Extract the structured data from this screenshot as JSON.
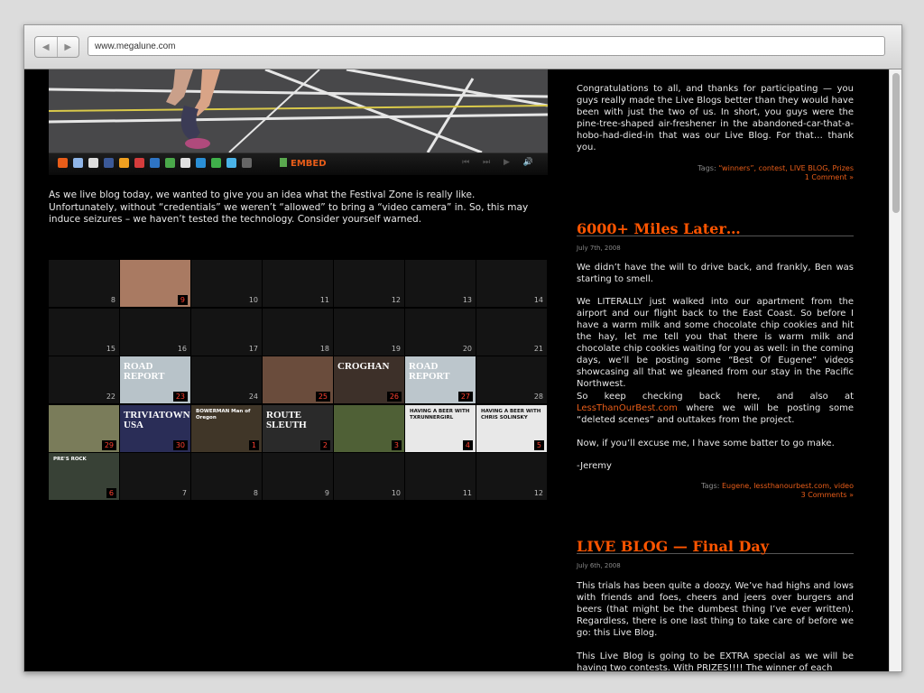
{
  "browser": {
    "url": "www.megalune.com",
    "back_glyph": "◀",
    "forward_glyph": "▶"
  },
  "left": {
    "toolbar": {
      "embed_label": "EMBED",
      "player_glyphs": "⏮ ⏭ ▶ 🔊"
    },
    "intro": "As we live blog today, we wanted to give you an idea what the Festival Zone is really like.  Unfortunately, without “credentials” we weren’t “allowed” to bring a “video camera” in.  So, this may induce seizures – we haven’t tested the technology.  Consider yourself warned.",
    "grid": [
      {
        "n": "8"
      },
      {
        "n": "9",
        "thumb": "#a97a62"
      },
      {
        "n": "10"
      },
      {
        "n": "11"
      },
      {
        "n": "12"
      },
      {
        "n": "13"
      },
      {
        "n": "14"
      },
      {
        "n": "15"
      },
      {
        "n": "16"
      },
      {
        "n": "17"
      },
      {
        "n": "18"
      },
      {
        "n": "19"
      },
      {
        "n": "20"
      },
      {
        "n": "21"
      },
      {
        "n": "22"
      },
      {
        "n": "23",
        "thumb": "#b8c3c9",
        "title": "ROAD REPORT"
      },
      {
        "n": "24"
      },
      {
        "n": "25",
        "thumb": "#6a4c3c"
      },
      {
        "n": "26",
        "thumb": "#3d3029",
        "title": "CROGHAN"
      },
      {
        "n": "27",
        "thumb": "#bcc6cc",
        "title": "ROAD REPORT"
      },
      {
        "n": "28"
      },
      {
        "n": "29",
        "thumb": "#7a7c5a"
      },
      {
        "n": "30",
        "thumb": "#2a2d57",
        "title": "TRIVIATOWN USA"
      },
      {
        "n": "1",
        "thumb": "#403628",
        "sub": "BOWERMAN Man of Oregon"
      },
      {
        "n": "2",
        "thumb": "#2a2a2a",
        "title": "ROUTE SLEUTH"
      },
      {
        "n": "3",
        "thumb": "#4f6036"
      },
      {
        "n": "4",
        "thumb": "#e8e8e8",
        "sub": "HAVING A BEER WITH TXRUNNERGIRL"
      },
      {
        "n": "5",
        "thumb": "#e8e8e8",
        "sub": "HAVING A BEER WITH CHRIS SOLINSKY"
      },
      {
        "n": "6",
        "thumb": "#384136",
        "sub": "PRE'S ROCK"
      },
      {
        "n": "7"
      },
      {
        "n": "8"
      },
      {
        "n": "9"
      },
      {
        "n": "10"
      },
      {
        "n": "11"
      },
      {
        "n": "12"
      }
    ]
  },
  "sidebar": {
    "p1": "Congratulations to all, and thanks for participating — you guys really made the Live Blogs better than they would have been with just the two of us.  In short, you guys were the pine-tree-shaped air-freshener in the abandoned-car-that-a-hobo-had-died-in that was our Live Blog.  For that… thank you.",
    "tags1_prefix": "Tags:",
    "tags1": "“winners”, contest, LIVE BLOG, Prizes",
    "comments1": "1 Comment »",
    "post2_title": "6000+ Miles Later…",
    "post2_date": "July 7th, 2008",
    "p2a": "We didn’t have the will to drive back, and frankly, Ben was starting to smell.",
    "p2b": "We LITERALLY just walked into our apartment from the airport and our flight back to the East Coast.  So before I have a warm milk and some chocolate chip cookies and hit the hay, let me tell you that there is warm milk and chocolate chip cookies waiting for you as well: in the coming days, we’ll be posting some “Best Of Eugene” videos showcasing all that we gleaned from our stay in the Pacific Northwest.",
    "p2c_1": "So keep checking back here, and also at ",
    "p2c_link": "LessThanOurBest.com",
    "p2c_2": " where we will be posting some “deleted scenes” and outtakes from the project.",
    "p2d": "Now, if you’ll excuse me, I have some batter to go make.",
    "p2e": "-Jeremy",
    "tags2_prefix": "Tags:",
    "tags2": "Eugene, lessthanourbest.com, video",
    "comments2": "3 Comments »",
    "post3_title": "LIVE BLOG — Final Day",
    "post3_date": "July 6th, 2008",
    "p3a": "This trials has been quite a doozy.  We’ve had highs and lows with friends and foes, cheers and jeers over burgers and beers (that might be the dumbest thing I’ve ever written). Regardless, there is one last thing to take care of before we go: this Live Blog.",
    "p3b": "This Live Blog is going to be EXTRA special as we will be having two contests.  With PRIZES!!!!  The winner of each"
  }
}
